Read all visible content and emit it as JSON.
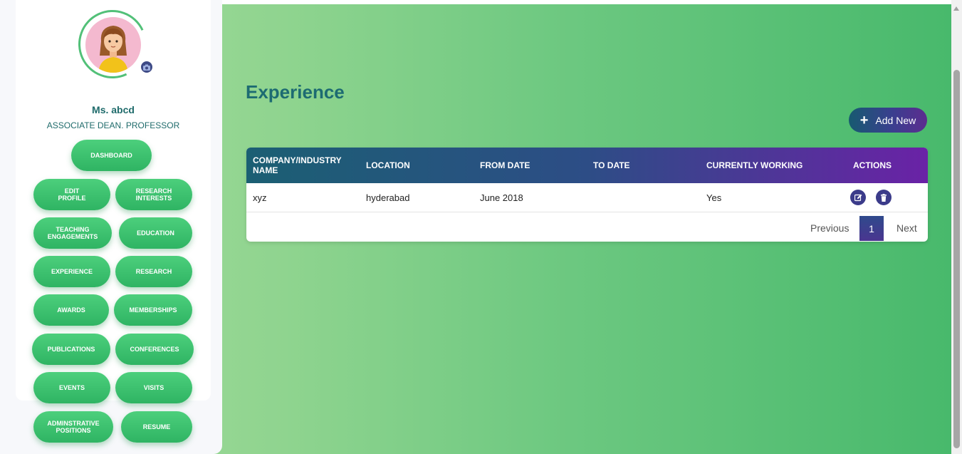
{
  "profile": {
    "name": "Ms. abcd",
    "role": "ASSOCIATE DEAN. PROFESSOR",
    "avatar_icon": "user-avatar-icon",
    "camera_icon": "camera-icon"
  },
  "nav": {
    "dashboard": "DASHBOARD",
    "edit_profile": "EDIT\nPROFILE",
    "research_interests": "RESEARCH\nINTERESTS",
    "teaching_engagements": "TEACHING\nENGAGEMENTS",
    "education": "EDUCATION",
    "experience": "EXPERIENCE",
    "research": "RESEARCH",
    "awards": "AWARDS",
    "memberships": "MEMBERSHIPS",
    "publications": "PUBLICATIONS",
    "conferences": "CONFERENCES",
    "events": "EVENTS",
    "visits": "VISITS",
    "administrative_positions": "ADMINSTRATIVE\nPOSITIONS",
    "resume": "RESUME"
  },
  "page": {
    "title": "Experience",
    "add_new_label": "Add New",
    "add_icon": "plus-icon"
  },
  "table": {
    "headers": {
      "company": "COMPANY/INDUSTRY NAME",
      "location": "LOCATION",
      "from_date": "FROM DATE",
      "to_date": "TO DATE",
      "currently_working": "CURRENTLY WORKING",
      "actions": "ACTIONS"
    },
    "rows": [
      {
        "company": "xyz",
        "location": "hyderabad",
        "from_date": "June 2018",
        "to_date": "",
        "currently_working": "Yes"
      }
    ],
    "action_icons": [
      "edit-icon",
      "trash-icon"
    ]
  },
  "pagination": {
    "previous": "Previous",
    "current_page": "1",
    "next": "Next"
  },
  "colors": {
    "accent_green": "#3cbf6e",
    "heading_teal": "#1d6b72",
    "header_gradient_start": "#1b5f73",
    "header_gradient_end": "#6a22a6"
  }
}
